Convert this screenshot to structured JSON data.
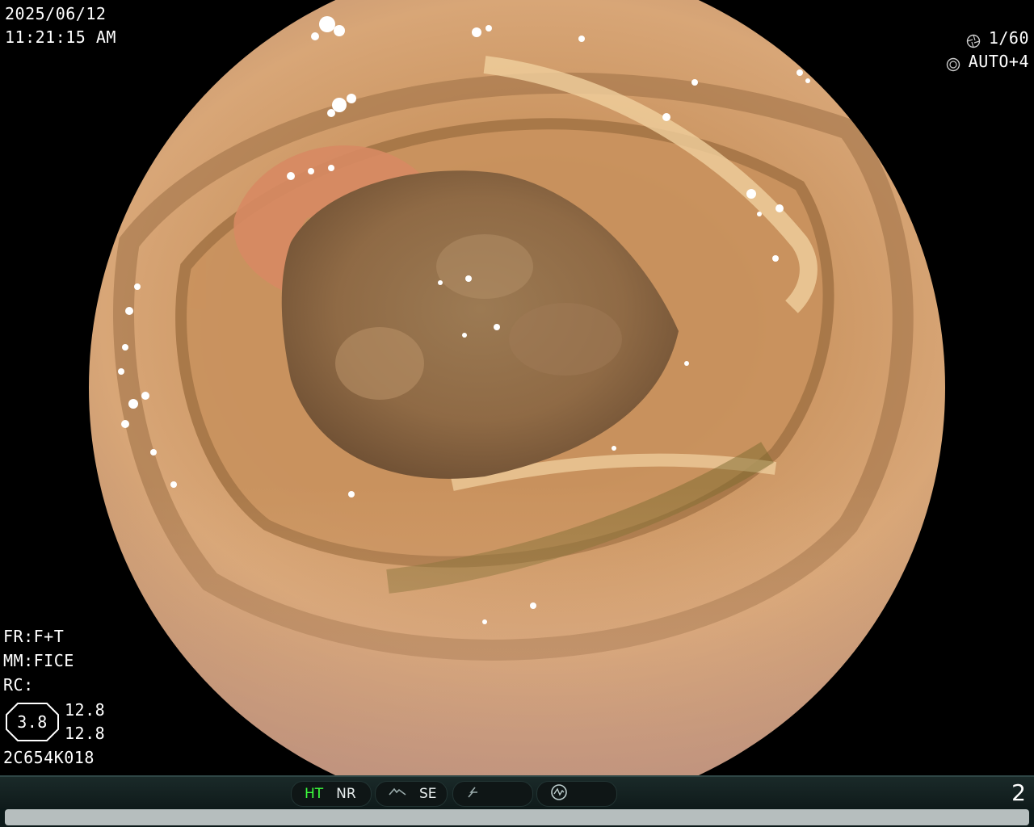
{
  "overlay": {
    "date": "2025/06/12",
    "time": "11:21:15 AM",
    "shutter": "1/60",
    "iris": "AUTO+4",
    "icons": {
      "shutter": "aperture-icon",
      "iris": "iris-icon"
    },
    "fr": "FR:F+T",
    "mm": "MM:FICE",
    "rc": "RC:",
    "rc_value": "3.8",
    "val_a": "12.8",
    "val_b": "12.8",
    "scope_id": "2C654K018"
  },
  "statusbar": {
    "ht": "HT",
    "nr": "NR",
    "se": "SE",
    "page": "2",
    "icons": {
      "se": "structure-enhance-icon",
      "edge": "edge-icon",
      "circle": "wave-circle-icon"
    },
    "colors": {
      "ht": "#3dff3d",
      "bar": "#1a2a29"
    }
  },
  "image": {
    "content": "endoscopic-view-colon-lumen"
  }
}
